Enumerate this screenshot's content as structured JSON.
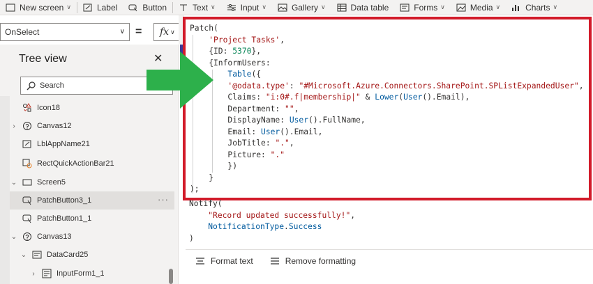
{
  "ribbon": {
    "items": [
      {
        "label": "New screen",
        "icon": "new-screen-icon",
        "dropdown": true
      },
      {
        "label": "Label",
        "icon": "label-icon",
        "dropdown": false
      },
      {
        "label": "Button",
        "icon": "button-icon",
        "dropdown": false
      },
      {
        "label": "Text",
        "icon": "text-icon",
        "dropdown": true
      },
      {
        "label": "Input",
        "icon": "input-icon",
        "dropdown": true
      },
      {
        "label": "Gallery",
        "icon": "gallery-icon",
        "dropdown": true
      },
      {
        "label": "Data table",
        "icon": "data-table-icon",
        "dropdown": false
      },
      {
        "label": "Forms",
        "icon": "forms-icon",
        "dropdown": true
      },
      {
        "label": "Media",
        "icon": "media-icon",
        "dropdown": true
      },
      {
        "label": "Charts",
        "icon": "charts-icon",
        "dropdown": true
      }
    ]
  },
  "formula_bar": {
    "property": "OnSelect",
    "equals": "=",
    "fx": "fx"
  },
  "tree_view": {
    "title": "Tree view",
    "close": "✕",
    "search_placeholder": "Search",
    "items": [
      {
        "label": "Icon18",
        "icon": "icon-shapes-icon",
        "expander": "",
        "selected": false
      },
      {
        "label": "Canvas12",
        "icon": "canvas-icon",
        "expander": "›",
        "selected": false
      },
      {
        "label": "LblAppName21",
        "icon": "label-edit-icon",
        "expander": "",
        "selected": false
      },
      {
        "label": "RectQuickActionBar21",
        "icon": "rectangle-icon",
        "expander": "",
        "selected": false
      },
      {
        "label": "Screen5",
        "icon": "screen-icon",
        "expander": "⌄",
        "selected": false
      },
      {
        "label": "PatchButton3_1",
        "icon": "button-click-icon",
        "expander": "",
        "selected": true
      },
      {
        "label": "PatchButton1_1",
        "icon": "button-click-icon",
        "expander": "",
        "selected": false
      },
      {
        "label": "Canvas13",
        "icon": "canvas-icon",
        "expander": "⌄",
        "selected": false
      },
      {
        "label": "DataCard25",
        "icon": "data-card-icon",
        "expander": "⌄",
        "selected": false
      },
      {
        "label": "InputForm1_1",
        "icon": "form-icon",
        "expander": "›",
        "selected": false
      }
    ],
    "more": "···"
  },
  "code": {
    "lines": [
      "Patch(",
      "    'Project Tasks',",
      "    {ID: 5370},",
      "    {InformUsers:",
      "        Table({",
      "        '@odata.type': \"#Microsoft.Azure.Connectors.SharePoint.SPListExpandedUser\",",
      "        Claims: \"i:0#.f|membership|\" & Lower(User().Email),",
      "        Department: \"\",",
      "        DisplayName: User().FullName,",
      "        Email: User().Email,",
      "        JobTitle: \".\",",
      "        Picture: \".\"",
      "        })",
      "    }",
      ");",
      "Notify(",
      "    \"Record updated successfully!\",",
      "    NotificationType.Success",
      ")"
    ]
  },
  "format_bar": {
    "format_text": "Format text",
    "remove_formatting": "Remove formatting"
  },
  "colors": {
    "highlight_border": "#d21b2a",
    "arrow": "#2db04b",
    "keyword": "#005a9e",
    "string": "#a31515",
    "number": "#098658"
  }
}
